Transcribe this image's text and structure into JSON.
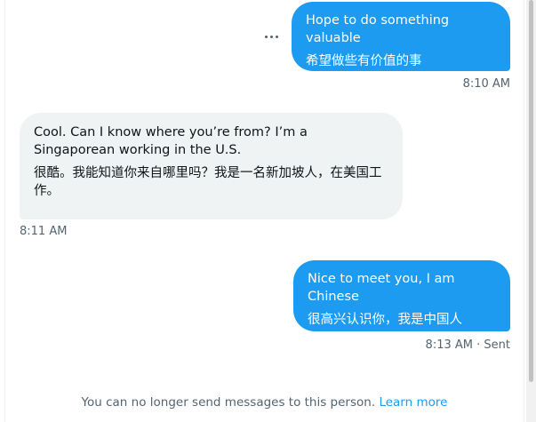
{
  "messages": [
    {
      "direction": "out",
      "lines": [
        "Hope to do something valuable",
        "希望做些有价值的事"
      ],
      "time": "8:10 AM"
    },
    {
      "direction": "in",
      "lines": [
        "Cool. Can I know where you’re from? I’m a Singaporean working in the U.S.",
        "很酷。我能知道你来自哪里吗？我是一名新加坡人，在美国工作。"
      ],
      "time": "8:11 AM"
    },
    {
      "direction": "out",
      "lines": [
        "Nice to meet you, I am Chinese",
        "很高兴认识你，我是中国人"
      ],
      "time": "8:13 AM",
      "status": "Sent"
    }
  ],
  "meta_separator": "·",
  "footer": {
    "notice": "You can no longer send messages to this person.",
    "link": "Learn more"
  },
  "colors": {
    "outgoing_bubble": "#1d9bf0",
    "incoming_bubble": "#eff3f4",
    "link": "#1d9bf0",
    "muted_text": "#536471"
  },
  "icons": {
    "more": "more-options-icon"
  }
}
